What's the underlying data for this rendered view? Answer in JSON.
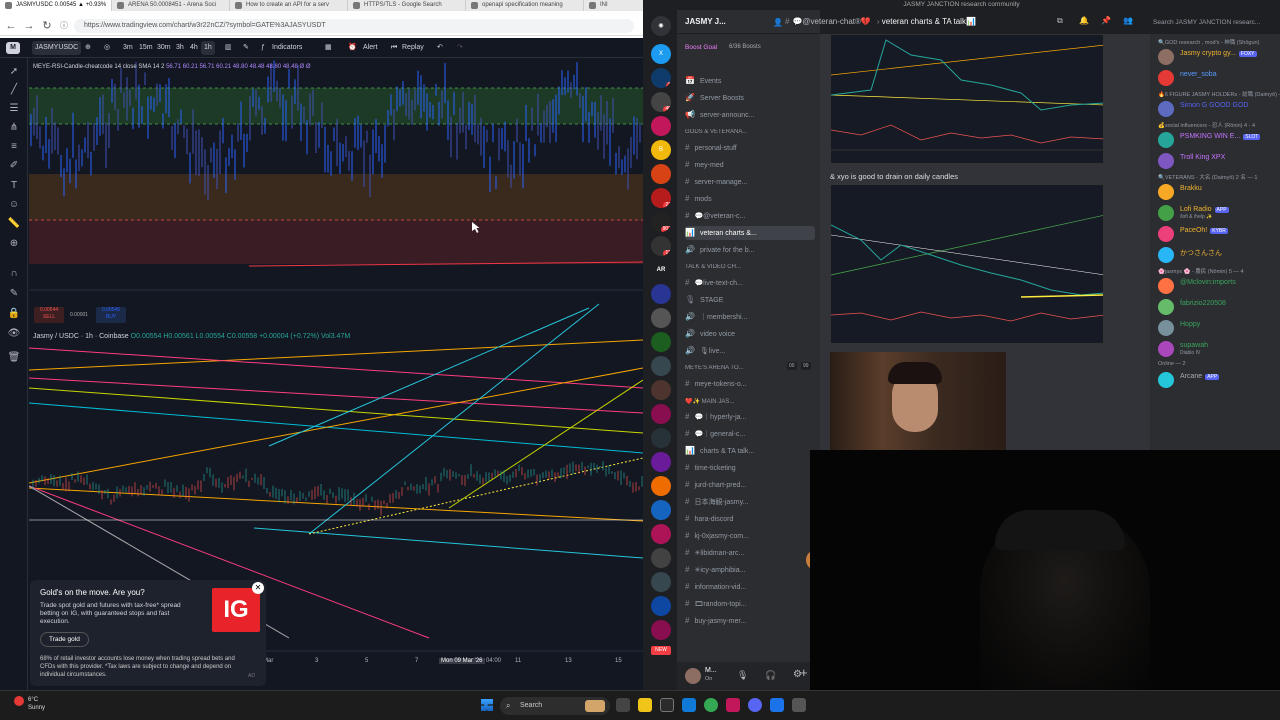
{
  "browser": {
    "tabs": [
      "JASMYUSDC 0.00545 ▲ +0.93%",
      "ARENA 50.0008451 - Arena Soci",
      "How to create an API for a serv",
      "HTTPS/TLS - Google Search",
      "openapi specification meaning",
      "INI"
    ],
    "url": "https://www.tradingview.com/chart/w3r22nCZ/?symbol=GATE%3AJASYUSDT"
  },
  "tv": {
    "symbol": "JASMYUSDC",
    "intervals": [
      "3m",
      "15m",
      "30m",
      "3h",
      "4h",
      "1h"
    ],
    "indicators_label": "Indicators",
    "alert_label": "Alert",
    "replay_label": "Replay",
    "indicator_legend": "MEYE-RSI-Candle-cheatcode 14 close SMA 14 2",
    "indicator_values": "56.71 60.21 56.71 60.21 48.80 48.48 48.80 48.48 Ø Ø",
    "price_legend_title": "Jasmy / USDC · 1h · Coinbase",
    "ohlc": "O0.00554 H0.00561 L0.00554 C0.00558 +0.00004 (+0.72%) Vol3.47M",
    "sell_price": "0.00544",
    "sell_label": "SELL",
    "spread": "0.00001",
    "buy_price": "0.00545",
    "buy_label": "BUY",
    "time_labels": [
      "Mar",
      "3",
      "5",
      "7",
      "Mon 09 Mar '26",
      "04:00",
      "11",
      "13",
      "15"
    ]
  },
  "ad": {
    "title": "Gold's on the move. Are you?",
    "body": "Trade spot gold and futures with tax-free* spread betting on IG, with guaranteed stops and fast execution.",
    "button": "Trade gold",
    "warning": "68% of retail investor accounts lose money when trading spread bets and CFDs with this provider. *Tax laws are subject to change and depend on individual circumstances.",
    "logo": "IG",
    "ad_badge": "AD"
  },
  "discord": {
    "window_title": "JASMY JANCTION research community",
    "server_name": "JASMY J...",
    "boost_goal": "Boost Goal",
    "boost_count": "6/36 Boosts",
    "channel_header": "veteran charts & TA talk📊",
    "channel_header_prefix": "💬@veteran-chat®💔",
    "search_placeholder": "Search JASMY JANCTION researc...",
    "message_text": "& xyo is good to drain on daily candles",
    "server_badges": [
      "8",
      "49",
      "",
      "",
      "27",
      "",
      "907",
      "12",
      "",
      "",
      "",
      "",
      "",
      "",
      "",
      "",
      "",
      ""
    ],
    "server_labels": [
      "",
      "",
      "",
      "",
      "",
      "",
      "",
      "",
      "AR"
    ],
    "channels": [
      {
        "type": "item",
        "icon": "📅",
        "label": "Events"
      },
      {
        "type": "item",
        "icon": "🚀",
        "label": "Server Boosts"
      },
      {
        "type": "item",
        "icon": "📢",
        "label": "server-announc..."
      },
      {
        "type": "cat",
        "label": "GODS & VETERANA..."
      },
      {
        "type": "item",
        "icon": "#",
        "label": "personal-stuff"
      },
      {
        "type": "item",
        "icon": "#",
        "label": "mey-med"
      },
      {
        "type": "item",
        "icon": "#",
        "label": "server-manage..."
      },
      {
        "type": "item",
        "icon": "#",
        "label": "mods"
      },
      {
        "type": "item",
        "icon": "#",
        "label": "💬@veteran-c..."
      },
      {
        "type": "sel",
        "icon": "📊",
        "label": "veteran charts &..."
      },
      {
        "type": "item",
        "icon": "🔊",
        "label": "private for the b..."
      },
      {
        "type": "cat",
        "label": "TALK & VIDEO CH..."
      },
      {
        "type": "item",
        "icon": "#",
        "label": "💬live-text-ch..."
      },
      {
        "type": "item",
        "icon": "🎙",
        "label": "STAGE"
      },
      {
        "type": "item",
        "icon": "🔊",
        "label": "｜membershi..."
      },
      {
        "type": "item",
        "icon": "🔊",
        "label": "video voice"
      },
      {
        "type": "item",
        "icon": "🔊",
        "label": "🎙live..."
      },
      {
        "type": "cat",
        "label": "MEYE's ARENA TO..."
      },
      {
        "type": "item",
        "icon": "#",
        "label": "meye-tokens-o..."
      },
      {
        "type": "cat",
        "label": "❤️✨ MAIN JAS..."
      },
      {
        "type": "item",
        "icon": "#",
        "label": "💬｜hyperly-ja..."
      },
      {
        "type": "item",
        "icon": "#",
        "label": "💬｜general-c..."
      },
      {
        "type": "item",
        "icon": "📊",
        "label": "charts & TA talk..."
      },
      {
        "type": "item",
        "icon": "#",
        "label": "time-ticketing"
      },
      {
        "type": "item",
        "icon": "#",
        "label": "jurd-chart-pred..."
      },
      {
        "type": "item",
        "icon": "#",
        "label": "日本海観-jasmy..."
      },
      {
        "type": "item",
        "icon": "#",
        "label": "hara-discord"
      },
      {
        "type": "item",
        "icon": "#",
        "label": "kj-0xjasmy-com..."
      },
      {
        "type": "item",
        "icon": "#",
        "label": "✳libidman-arc..."
      },
      {
        "type": "item",
        "icon": "#",
        "label": "✳icy-amphibia..."
      },
      {
        "type": "item",
        "icon": "#",
        "label": "information-vid..."
      },
      {
        "type": "item",
        "icon": "#",
        "label": "🎞random-topi..."
      },
      {
        "type": "item",
        "icon": "#",
        "label": "buy-jasmy-mer..."
      }
    ],
    "voice_count": "00",
    "voice_count2": "99",
    "new_badge": "NEW",
    "user": {
      "name": "M...",
      "status": "On"
    },
    "members": [
      {
        "type": "cat",
        "label": "🔍GOD research , mod's - 神職 (Shōgun)"
      },
      {
        "type": "mem",
        "name": "Jasmy crypto gy...",
        "color": "#f0b232",
        "tag": "FOXY",
        "sub": ""
      },
      {
        "type": "mem",
        "name": "never_soba",
        "color": "#5a9cff",
        "tag": "",
        "sub": ""
      },
      {
        "type": "cat",
        "label": "🔥6 FIGURE JASMY HOLDERs - 総職 (Daimyō) - 2"
      },
      {
        "type": "mem",
        "name": "Simon G GOOD GOD",
        "color": "#5865f2",
        "tag": "",
        "sub": ""
      },
      {
        "type": "cat",
        "label": "💰social influencers - 忍人 (Rōnin) 4 - 4"
      },
      {
        "type": "mem",
        "name": "PSMKING WIN E...",
        "color": "#c774ff",
        "tag": "SLOT",
        "sub": ""
      },
      {
        "type": "mem",
        "name": "Troll King XPX",
        "color": "#c774ff",
        "tag": "",
        "sub": ""
      },
      {
        "type": "cat",
        "label": "🔍VETERANS - 大名 (Daimyō) 2 名 — 1"
      },
      {
        "type": "mem",
        "name": "Brakku",
        "color": "#f0b232",
        "tag": "",
        "sub": ""
      },
      {
        "type": "mem",
        "name": "Lofi Radio",
        "color": "#f0b232",
        "tag": "APP",
        "sub": "/lofi & /help ✨"
      },
      {
        "type": "mem",
        "name": "PaceOh!",
        "color": "#f0b232",
        "tag": "KYBR",
        "sub": ""
      },
      {
        "type": "mem",
        "name": "かつさんさん",
        "color": "#f0b232",
        "tag": "",
        "sub": ""
      },
      {
        "type": "cat",
        "label": "🌸jasmys 🌸 - 農民 (Nōmin) 5 — 4"
      },
      {
        "type": "mem",
        "name": "@Mclovin:imports",
        "color": "#3ba55c",
        "tag": "",
        "sub": ""
      },
      {
        "type": "mem",
        "name": "fabrizio220508",
        "color": "#3ba55c",
        "tag": "",
        "sub": ""
      },
      {
        "type": "mem",
        "name": "Hoppy",
        "color": "#3ba55c",
        "tag": "",
        "sub": ""
      },
      {
        "type": "mem",
        "name": "supawah",
        "color": "#3ba55c",
        "tag": "",
        "sub": "Diablo IV"
      },
      {
        "type": "cat",
        "label": "Online — 2"
      },
      {
        "type": "mem",
        "name": "Arcane",
        "color": "#aaaaaa",
        "tag": "APP",
        "sub": ""
      }
    ]
  },
  "taskbar": {
    "temperature": "6°C",
    "weather": "Sunny",
    "search": "Search"
  }
}
